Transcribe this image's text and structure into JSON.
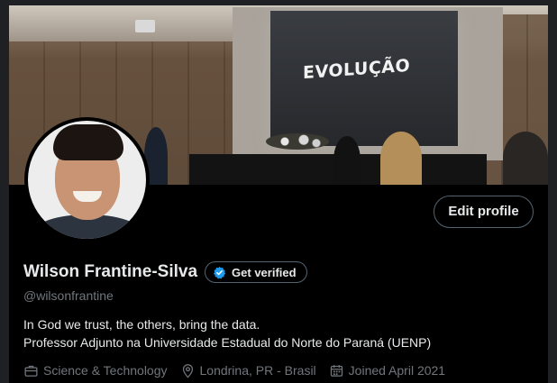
{
  "banner": {
    "screen_text": "EVOLUÇÃO"
  },
  "profile": {
    "display_name": "Wilson Frantine-Silva",
    "handle": "@wilsonfrantine",
    "get_verified_label": "Get verified",
    "edit_profile_label": "Edit profile",
    "bio_line_1": "In God we trust, the others, bring the data.",
    "bio_line_2": "Professor Adjunto na Universidade Estadual do Norte do Paraná (UENP)",
    "category": "Science & Technology",
    "location": "Londrina, PR - Brasil",
    "joined": "Joined April 2021"
  },
  "icons": {
    "verified": "verified-badge-icon",
    "category": "briefcase-icon",
    "location": "location-pin-icon",
    "joined": "calendar-icon"
  },
  "colors": {
    "background": "#000000",
    "text_primary": "#e7e9ea",
    "text_secondary": "#71767b",
    "border": "#536471",
    "verified_blue": "#1d9bf0"
  }
}
